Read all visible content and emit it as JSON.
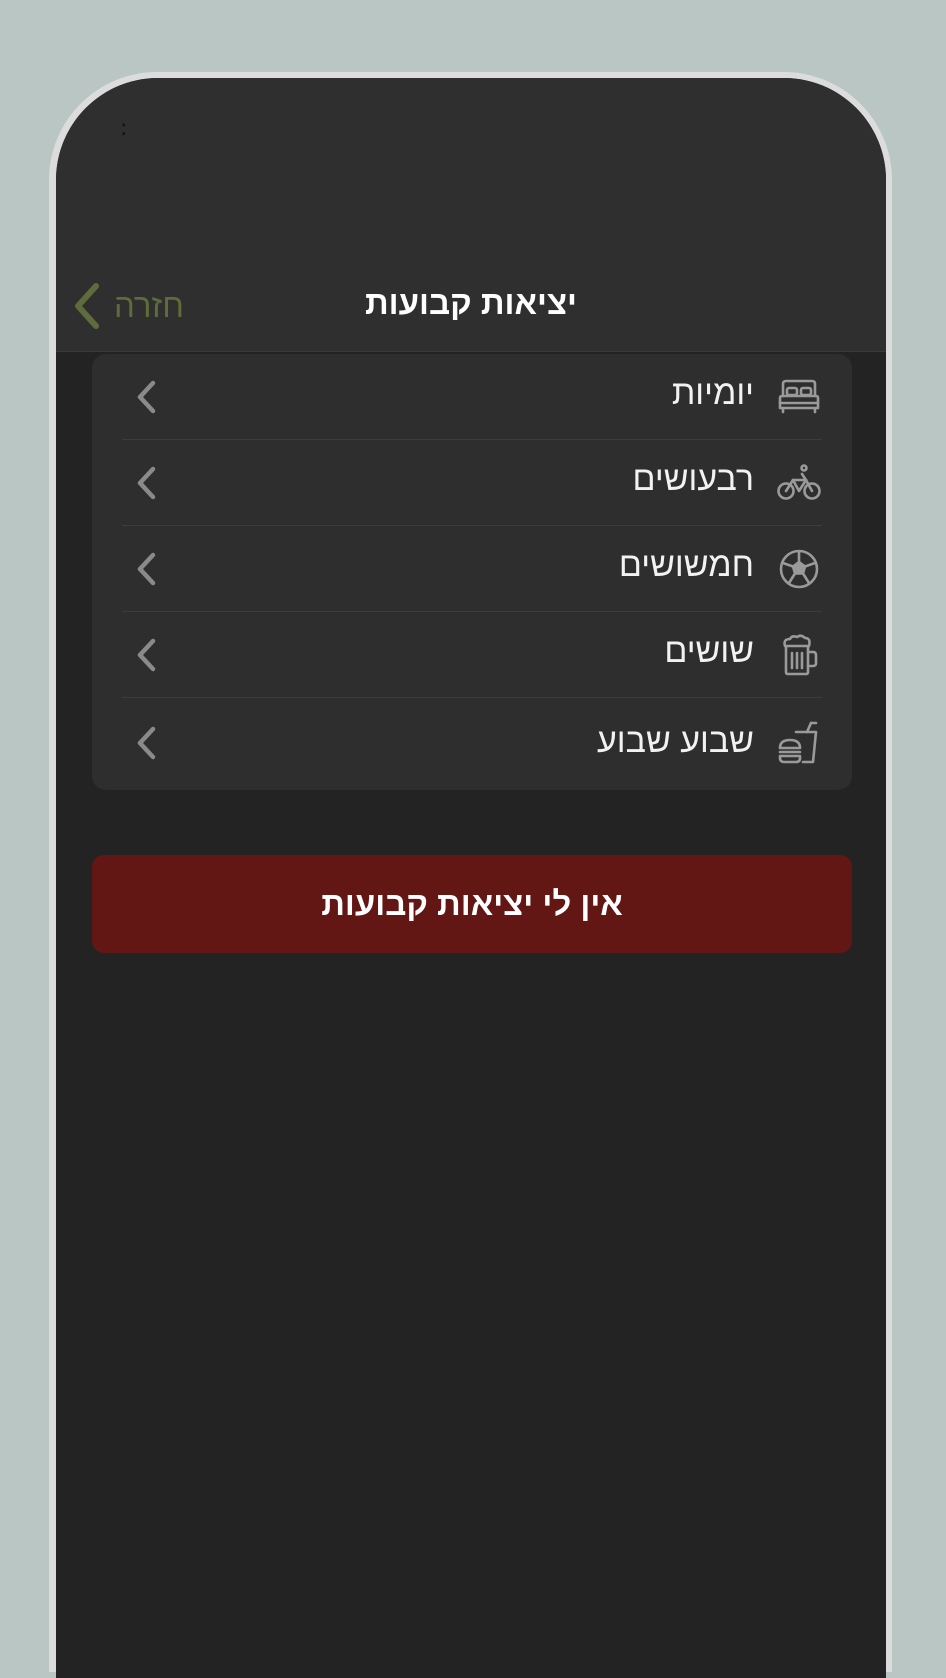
{
  "status_bar": {
    "dots": ":"
  },
  "nav": {
    "back_label": "חזרה",
    "title": "יציאות קבועות"
  },
  "list": {
    "items": [
      {
        "label": "יומיות",
        "icon": "bed-icon"
      },
      {
        "label": "רבעושים",
        "icon": "bicycle-icon"
      },
      {
        "label": "חמשושים",
        "icon": "soccer-ball-icon"
      },
      {
        "label": "שושים",
        "icon": "beer-mug-icon"
      },
      {
        "label": "שבוע שבוע",
        "icon": "fast-food-icon"
      }
    ]
  },
  "action": {
    "label": "אין לי יציאות קבועות"
  },
  "colors": {
    "background": "#b9c6c4",
    "screen": "#232323",
    "header": "#2f2f2f",
    "card": "#2e2e2e",
    "back_accent": "#5e6b3a",
    "danger_button": "#631714"
  }
}
